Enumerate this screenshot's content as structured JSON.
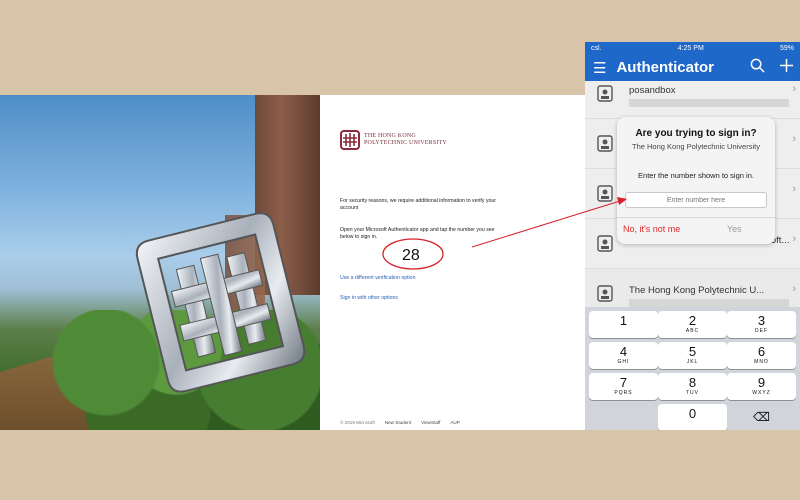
{
  "signin": {
    "org_name_line1": "THE HONG KONG",
    "org_name_line2": "POLYTECHNIC UNIVERSITY",
    "security_text": "For security reasons, we require additional information to verify your account",
    "instruction_text": "Open your Microsoft Authenticator app and tap the number you see below to sign in.",
    "number_shown": "28",
    "link_different": "Use a different verification option",
    "link_other": "Sign in with other options",
    "footer": [
      "© 2019 Microsoft",
      "New Student",
      "ViewStaff",
      "AUP"
    ]
  },
  "phone": {
    "status_left": "csl.",
    "status_time": "4:25 PM",
    "status_right": "59%",
    "app_title": "Authenticator",
    "icons": [
      "menu-icon",
      "search-icon",
      "add-icon"
    ],
    "accounts": [
      {
        "name": "posandbox"
      },
      {
        "name": ""
      },
      {
        "name": ""
      },
      {
        "name": "...microsoft..."
      },
      {
        "name": "The Hong Kong Polytechnic U..."
      }
    ],
    "dialog": {
      "title": "Are you trying to sign in?",
      "subtitle": "The Hong Kong Polytechnic University",
      "instruction": "Enter the number shown to sign in.",
      "input_placeholder": "Enter number here",
      "no_label": "No, it's not me",
      "yes_label": "Yes"
    },
    "keypad": [
      {
        "n": "1",
        "l": ""
      },
      {
        "n": "2",
        "l": "ABC"
      },
      {
        "n": "3",
        "l": "DEF"
      },
      {
        "n": "4",
        "l": "GHI"
      },
      {
        "n": "5",
        "l": "JKL"
      },
      {
        "n": "6",
        "l": "MNO"
      },
      {
        "n": "7",
        "l": "PQRS"
      },
      {
        "n": "8",
        "l": "TUV"
      },
      {
        "n": "9",
        "l": "WXYZ"
      },
      {
        "n": "",
        "l": ""
      },
      {
        "n": "0",
        "l": ""
      },
      {
        "n": "⌫",
        "l": ""
      }
    ]
  },
  "colors": {
    "accent": "#1e68c9",
    "annotation": "#d6202a",
    "background": "#d8c4a9"
  }
}
